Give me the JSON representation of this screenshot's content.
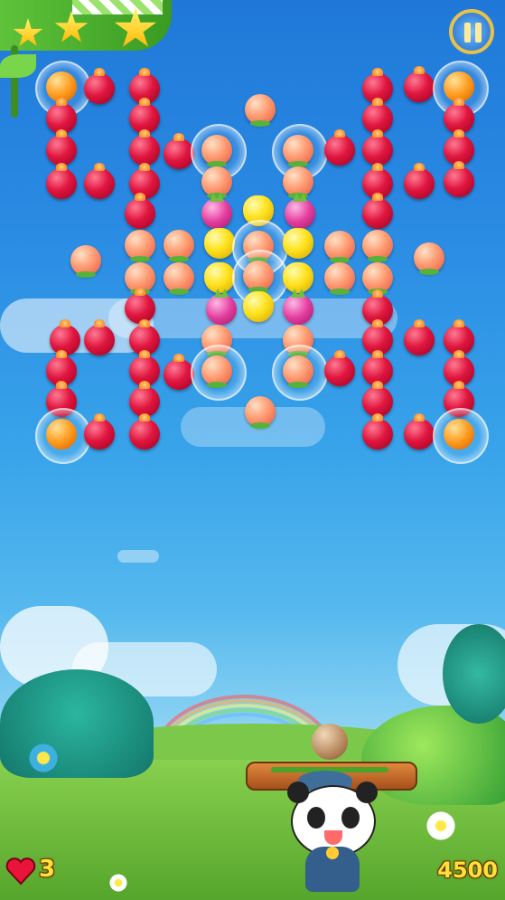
{
  "hud": {
    "stars_earned": 3,
    "lives": "3",
    "score": "4500",
    "pause_icon": "pause-icon",
    "heart_icon": "heart-icon"
  },
  "board": {
    "fruit_types": [
      "pomegranate",
      "peach",
      "mango",
      "dragon-fruit",
      "orange"
    ]
  },
  "player": {
    "character": "panda",
    "held_item": "wooden-log",
    "next_ball": "walnut"
  },
  "colors": {
    "score": "#ffe13a",
    "heart": "#e8143a"
  }
}
